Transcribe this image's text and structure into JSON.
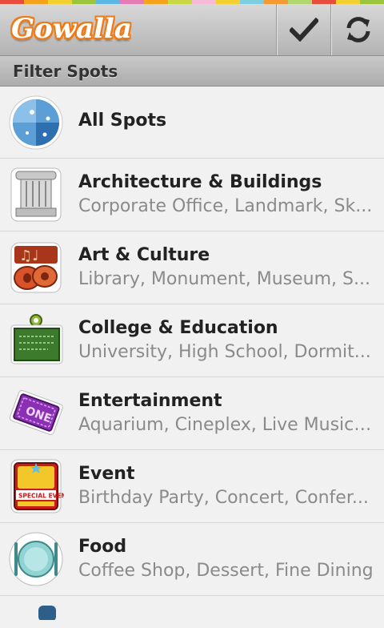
{
  "app": {
    "brand": "Gowalla",
    "brand_color": "#f07a15"
  },
  "rainbow_colors": [
    "#e94b3c",
    "#f7a21b",
    "#f3d02f",
    "#9bc53d",
    "#5bb8e3",
    "#e57ab5",
    "#f7a21b",
    "#c9d845",
    "#f6b9d6",
    "#f3d02f",
    "#7fcde0",
    "#f59a33",
    "#b1d86f",
    "#e94b3c",
    "#f3d02f",
    "#9bc53d"
  ],
  "toolbar": {
    "check_icon": "check-icon",
    "refresh_icon": "refresh-icon"
  },
  "section": {
    "title": "Filter Spots"
  },
  "categories": [
    {
      "title": "All Spots",
      "subtitle": "",
      "icon": "globe-icon"
    },
    {
      "title": "Architecture & Buildings",
      "subtitle": "Corporate Office, Landmark, Sk...",
      "icon": "column-icon"
    },
    {
      "title": "Art & Culture",
      "subtitle": "Library, Monument, Museum, S...",
      "icon": "art-culture-icon"
    },
    {
      "title": "College & Education",
      "subtitle": "University, High School, Dormit...",
      "icon": "chalkboard-icon"
    },
    {
      "title": "Entertainment",
      "subtitle": "Aquarium, Cineplex, Live Music, ...",
      "icon": "ticket-icon"
    },
    {
      "title": "Event",
      "subtitle": "Birthday Party, Concert, Confer...",
      "icon": "special-event-icon"
    },
    {
      "title": "Food",
      "subtitle": "Coffee Shop, Dessert, Fine Dining",
      "icon": "plate-icon"
    }
  ],
  "icon_text": {
    "ticket": "ONE",
    "event_banner": "SPECIAL EVENT"
  }
}
